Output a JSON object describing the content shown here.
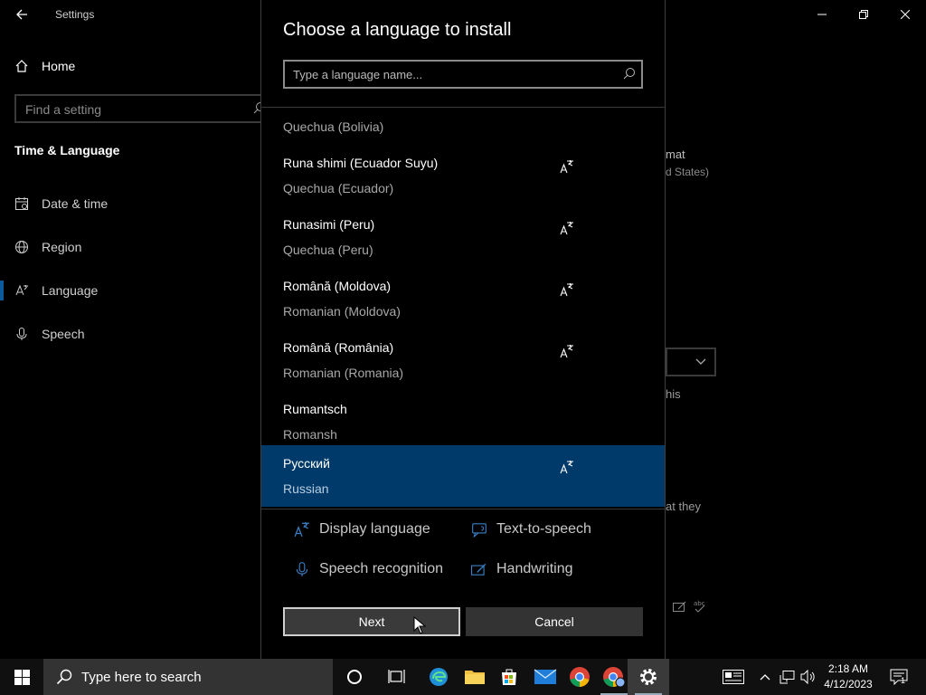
{
  "window": {
    "app_title": "Settings",
    "home_label": "Home",
    "find_placeholder": "Find a setting",
    "section_title": "Time & Language",
    "nav": [
      {
        "label": "Date & time",
        "icon": "calendar-icon"
      },
      {
        "label": "Region",
        "icon": "globe-icon"
      },
      {
        "label": "Language",
        "icon": "language-icon",
        "selected": true
      },
      {
        "label": "Speech",
        "icon": "microphone-icon"
      }
    ],
    "right_fragments": {
      "r1": "mat",
      "r2": "d States)",
      "r3": "his",
      "r4": "at they"
    }
  },
  "dialog": {
    "title": "Choose a language to install",
    "search_placeholder": "Type a language name...",
    "languages": [
      {
        "native": "",
        "english": "Quechua (Bolivia)",
        "display_language": false
      },
      {
        "native": "Runa shimi (Ecuador Suyu)",
        "english": "Quechua (Ecuador)",
        "display_language": true
      },
      {
        "native": "Runasimi (Peru)",
        "english": "Quechua (Peru)",
        "display_language": true
      },
      {
        "native": "Română (Moldova)",
        "english": "Romanian (Moldova)",
        "display_language": true
      },
      {
        "native": "Română (România)",
        "english": "Romanian (Romania)",
        "display_language": true
      },
      {
        "native": "Rumantsch",
        "english": "Romansh",
        "display_language": false
      },
      {
        "native": "Русский",
        "english": "Russian",
        "display_language": true,
        "selected": true
      }
    ],
    "features": {
      "display_language": "Display language",
      "text_to_speech": "Text-to-speech",
      "speech_recognition": "Speech recognition",
      "handwriting": "Handwriting"
    },
    "next_label": "Next",
    "cancel_label": "Cancel"
  },
  "taskbar": {
    "search_placeholder": "Type here to search",
    "time": "2:18 AM",
    "date": "4/12/2023",
    "notification_count": "1"
  },
  "colors": {
    "selection": "#003a6a",
    "accent": "#0a5a9c"
  }
}
